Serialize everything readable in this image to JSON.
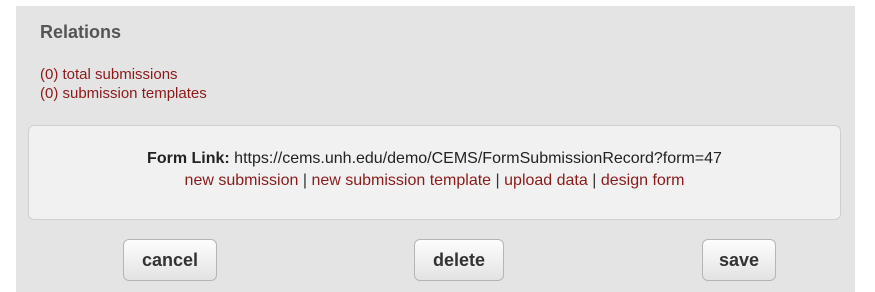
{
  "relations": {
    "title": "Relations",
    "links": [
      "(0) total submissions",
      "(0) submission templates"
    ]
  },
  "form_link": {
    "label": "Form Link:",
    "url": "https://cems.unh.edu/demo/CEMS/FormSubmissionRecord?form=47",
    "actions": [
      "new submission",
      "new submission template",
      "upload data",
      "design form"
    ],
    "separator": "|"
  },
  "buttons": {
    "cancel": "cancel",
    "delete": "delete",
    "save": "save"
  },
  "colors": {
    "panel_bg": "#e4e4e4",
    "box_bg": "#f1f1f1",
    "link": "#8b1a1a",
    "title": "#555555"
  }
}
